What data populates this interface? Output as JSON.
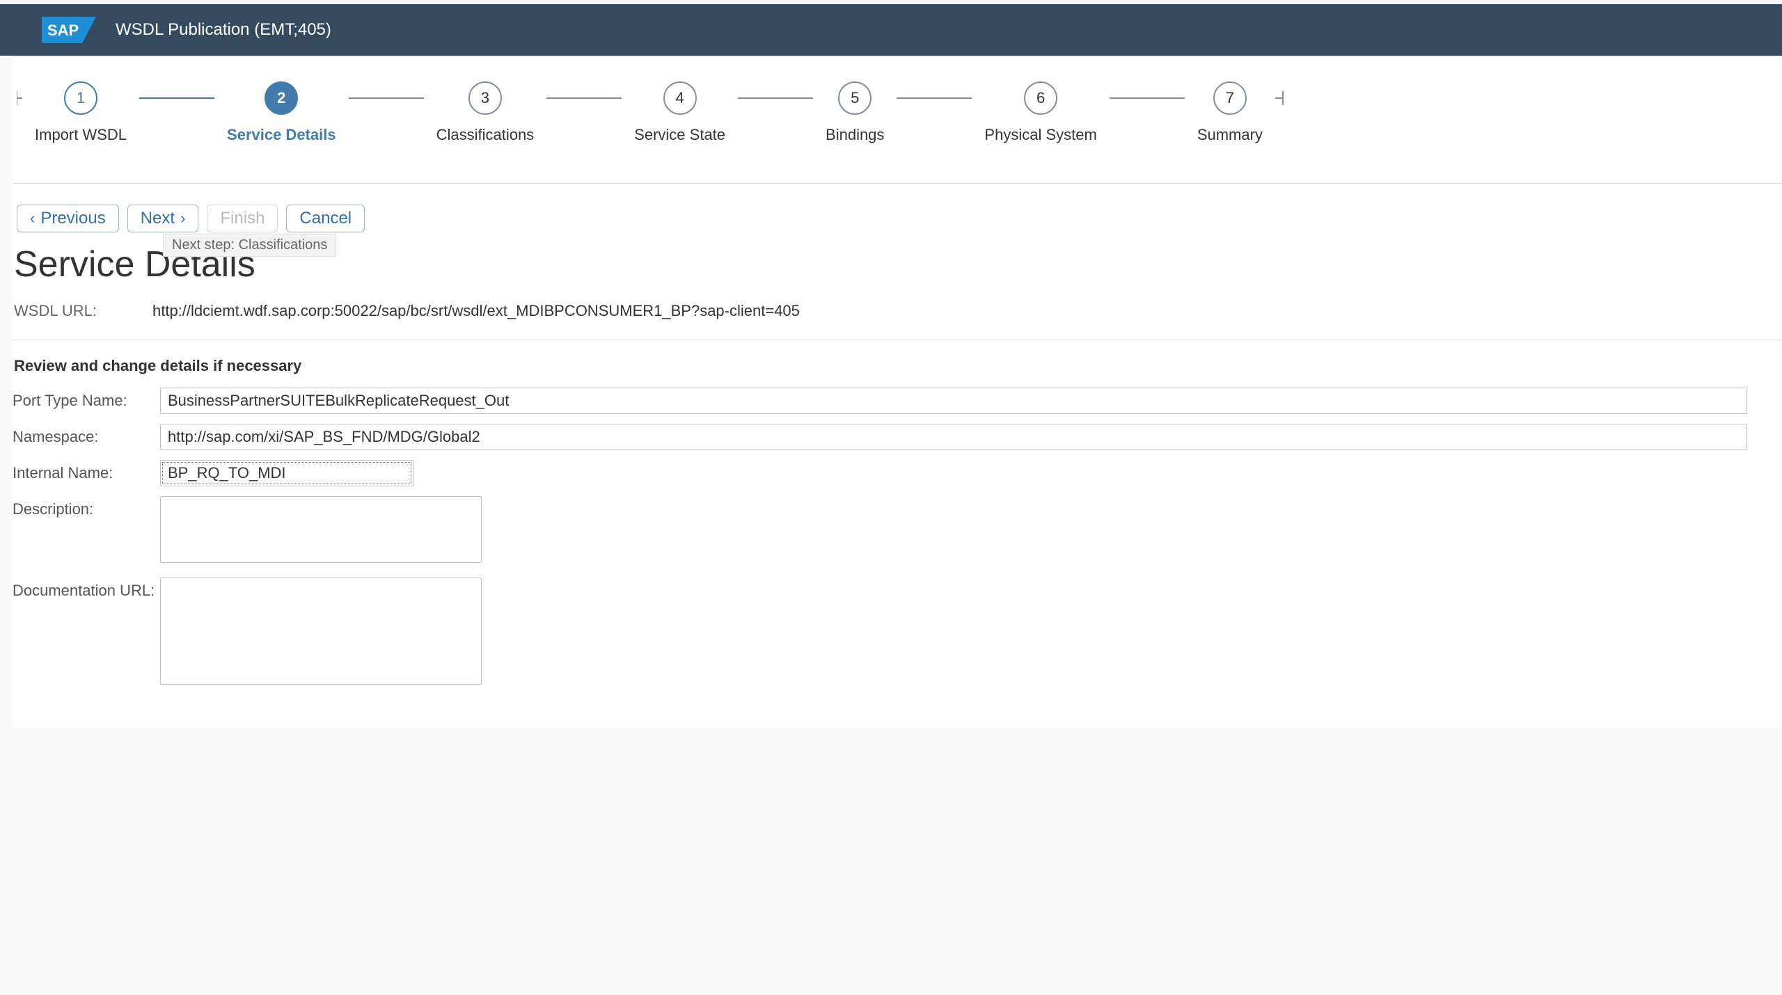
{
  "header": {
    "title": "WSDL Publication (EMT;405)"
  },
  "wizard": {
    "steps": [
      {
        "num": "1",
        "label": "Import WSDL",
        "state": "done"
      },
      {
        "num": "2",
        "label": "Service Details",
        "state": "active"
      },
      {
        "num": "3",
        "label": "Classifications",
        "state": ""
      },
      {
        "num": "4",
        "label": "Service State",
        "state": ""
      },
      {
        "num": "5",
        "label": "Bindings",
        "state": ""
      },
      {
        "num": "6",
        "label": "Physical System",
        "state": ""
      },
      {
        "num": "7",
        "label": "Summary",
        "state": ""
      }
    ]
  },
  "buttons": {
    "previous": "Previous",
    "next": "Next",
    "finish": "Finish",
    "cancel": "Cancel",
    "next_tooltip": "Next step: Classifications"
  },
  "page": {
    "heading": "Service Details",
    "wsdl_url_label": "WSDL URL:",
    "wsdl_url_value": "http://ldciemt.wdf.sap.corp:50022/sap/bc/srt/wsdl/ext_MDIBPCONSUMER1_BP?sap-client=405",
    "subtitle": "Review and change details if necessary"
  },
  "form": {
    "port_type_name": {
      "label": "Port Type Name:",
      "value": "BusinessPartnerSUITEBulkReplicateRequest_Out"
    },
    "namespace": {
      "label": "Namespace:",
      "value": "http://sap.com/xi/SAP_BS_FND/MDG/Global2"
    },
    "internal_name": {
      "label": "Internal Name:",
      "value": "BP_RQ_TO_MDI"
    },
    "description": {
      "label": "Description:",
      "value": ""
    },
    "doc_url": {
      "label": "Documentation URL:",
      "value": ""
    }
  }
}
